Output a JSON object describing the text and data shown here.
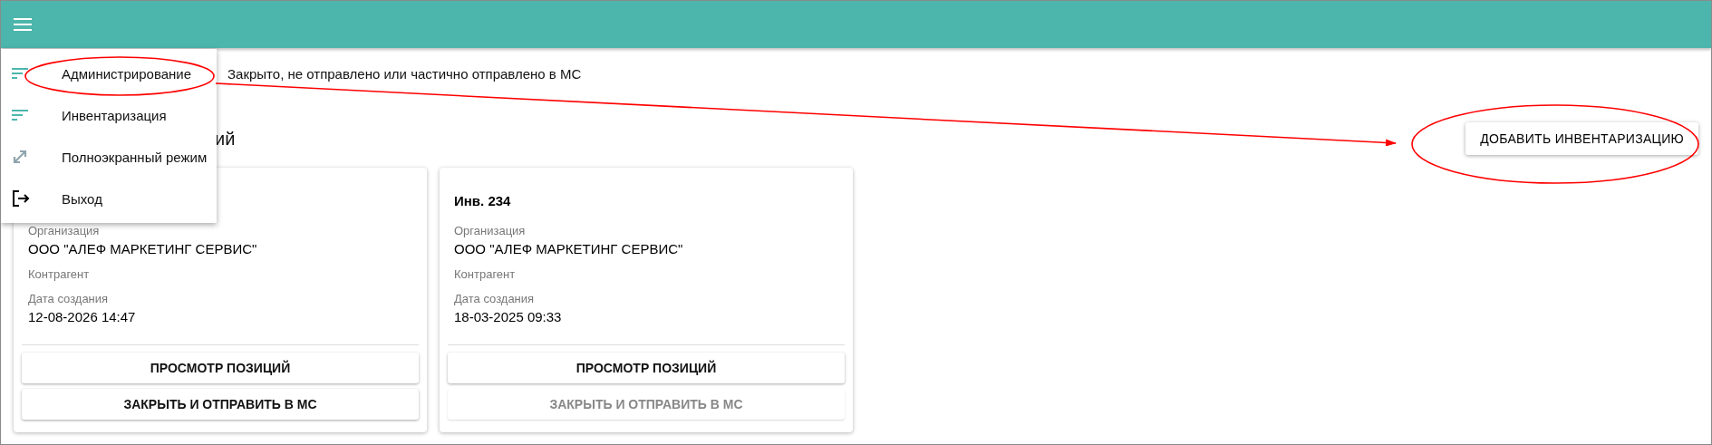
{
  "filter_text": "Закрыто, не отправлено или частично отправлено в МС",
  "heading": "ий",
  "add_button": "ДОБАВИТЬ ИНВЕНТАРИЗАЦИЮ",
  "cards": [
    {
      "fields": [
        {
          "label": "Организация",
          "value": "ООО \"АЛЕФ МАРКЕТИНГ СЕРВИС\""
        },
        {
          "label": "Контрагент"
        },
        {
          "label": "Дата создания",
          "value": "12-08-2026 14:47"
        }
      ],
      "buttons": [
        {
          "label": "ПРОСМОТР ПОЗИЦИЙ",
          "disabled": false
        },
        {
          "label": "ЗАКРЫТЬ И ОТПРАВИТЬ В МС",
          "disabled": false
        }
      ]
    },
    {
      "title": "Инв. 234",
      "fields": [
        {
          "label": "Организация",
          "value": "ООО \"АЛЕФ МАРКЕТИНГ СЕРВИС\""
        },
        {
          "label": "Контрагент"
        },
        {
          "label": "Дата создания",
          "value": "18-03-2025 09:33"
        }
      ],
      "buttons": [
        {
          "label": "ПРОСМОТР ПОЗИЦИЙ",
          "disabled": false
        },
        {
          "label": "ЗАКРЫТЬ И ОТПРАВИТЬ В МС",
          "disabled": true
        }
      ]
    }
  ],
  "menu": {
    "items": [
      {
        "kind": "filter",
        "label": "Администрирование"
      },
      {
        "kind": "filter",
        "label": "Инвентаризация"
      },
      {
        "kind": "fullscreen",
        "label": "Полноэкранный режим"
      },
      {
        "kind": "exit",
        "label": "Выход"
      }
    ]
  }
}
